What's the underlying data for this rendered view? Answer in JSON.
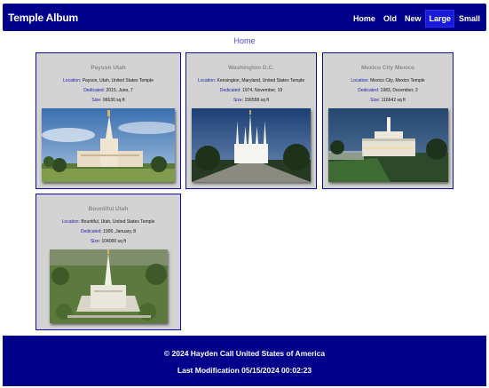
{
  "header": {
    "title": "Temple Album",
    "nav": [
      "Home",
      "Old",
      "New",
      "Large",
      "Small"
    ],
    "active": "Large"
  },
  "page": {
    "heading": "Home"
  },
  "labels": {
    "location": "Location:",
    "dedicated": "Dedicated:",
    "size": "Size:"
  },
  "temples": [
    {
      "name": "Payson Utah",
      "location": "Payson, Utah, United States Temple",
      "dedicated": "2015, June, 7",
      "size": "96630 sq ft",
      "image": "payson-utah-temple-photo"
    },
    {
      "name": "Washington D.C.",
      "location": "Kensington, Maryland, United States Temple",
      "dedicated": "1974, November, 19",
      "size": "156558 sq ft",
      "image": "washington-dc-temple-photo"
    },
    {
      "name": "Mexico City Mexico",
      "location": "Mexico City, Mexico Temple",
      "dedicated": "1983, December, 2",
      "size": "116642 sq ft",
      "image": "mexico-city-temple-photo"
    },
    {
      "name": "Bountiful Utah",
      "location": "Bountiful, Utah, United States Temple",
      "dedicated": "1995, January, 8",
      "size": "104000 sq ft",
      "image": "bountiful-utah-temple-photo"
    }
  ],
  "footer": {
    "copyright": "© 2024 Hayden Call United States of America",
    "modified": "Last Modification 05/15/2024 00:02:23"
  },
  "colors": {
    "header_bg": "#00008b",
    "card_bg": "#d3d3d3",
    "card_border": "#0b0b9e",
    "link": "#4a49c9"
  }
}
